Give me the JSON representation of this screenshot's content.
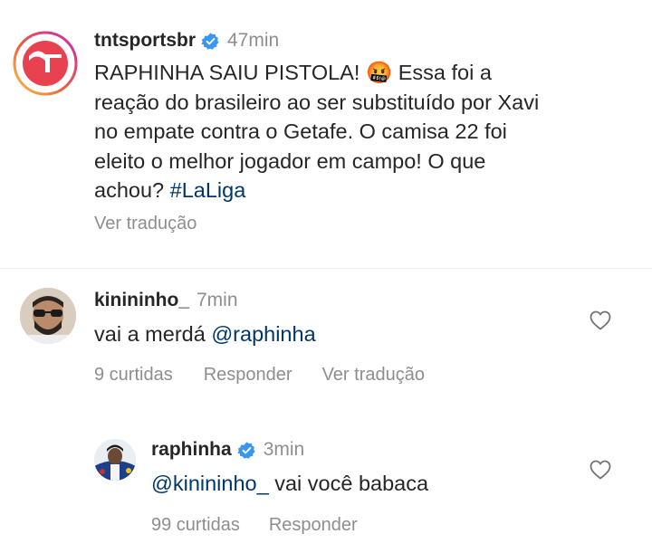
{
  "post": {
    "username": "tntsportsbr",
    "time": "47min",
    "caption_part1": "RAPHINHA SAIU PISTOLA! ",
    "caption_emoji": "🤬",
    "caption_line1_rest": " Essa foi a",
    "caption_line2": "reação do brasileiro ao ser substituído por Xavi",
    "caption_line3": "no empate contra o Getafe. O camisa 22 foi",
    "caption_line4": "eleito o melhor jogador em campo! O que",
    "caption_line5_pre": "achou? ",
    "hashtag": "#LaLiga",
    "translate_label": "Ver tradução"
  },
  "comments": [
    {
      "username": "kinininho_",
      "time": "7min",
      "text_pre": "vai a merdá ",
      "mention": "@raphinha",
      "text_post": "",
      "likes": "9 curtidas",
      "reply_label": "Responder",
      "translate_label": "Ver tradução"
    },
    {
      "username": "raphinha",
      "time": "3min",
      "text_pre": "",
      "mention": "@kinininho_",
      "text_post": " vai você babaca",
      "likes": "99 curtidas",
      "reply_label": "Responder"
    }
  ],
  "colors": {
    "verified": "#3897f0",
    "link": "#00376b",
    "muted": "#8e8e8e",
    "tnt_red": "#e8414f"
  }
}
